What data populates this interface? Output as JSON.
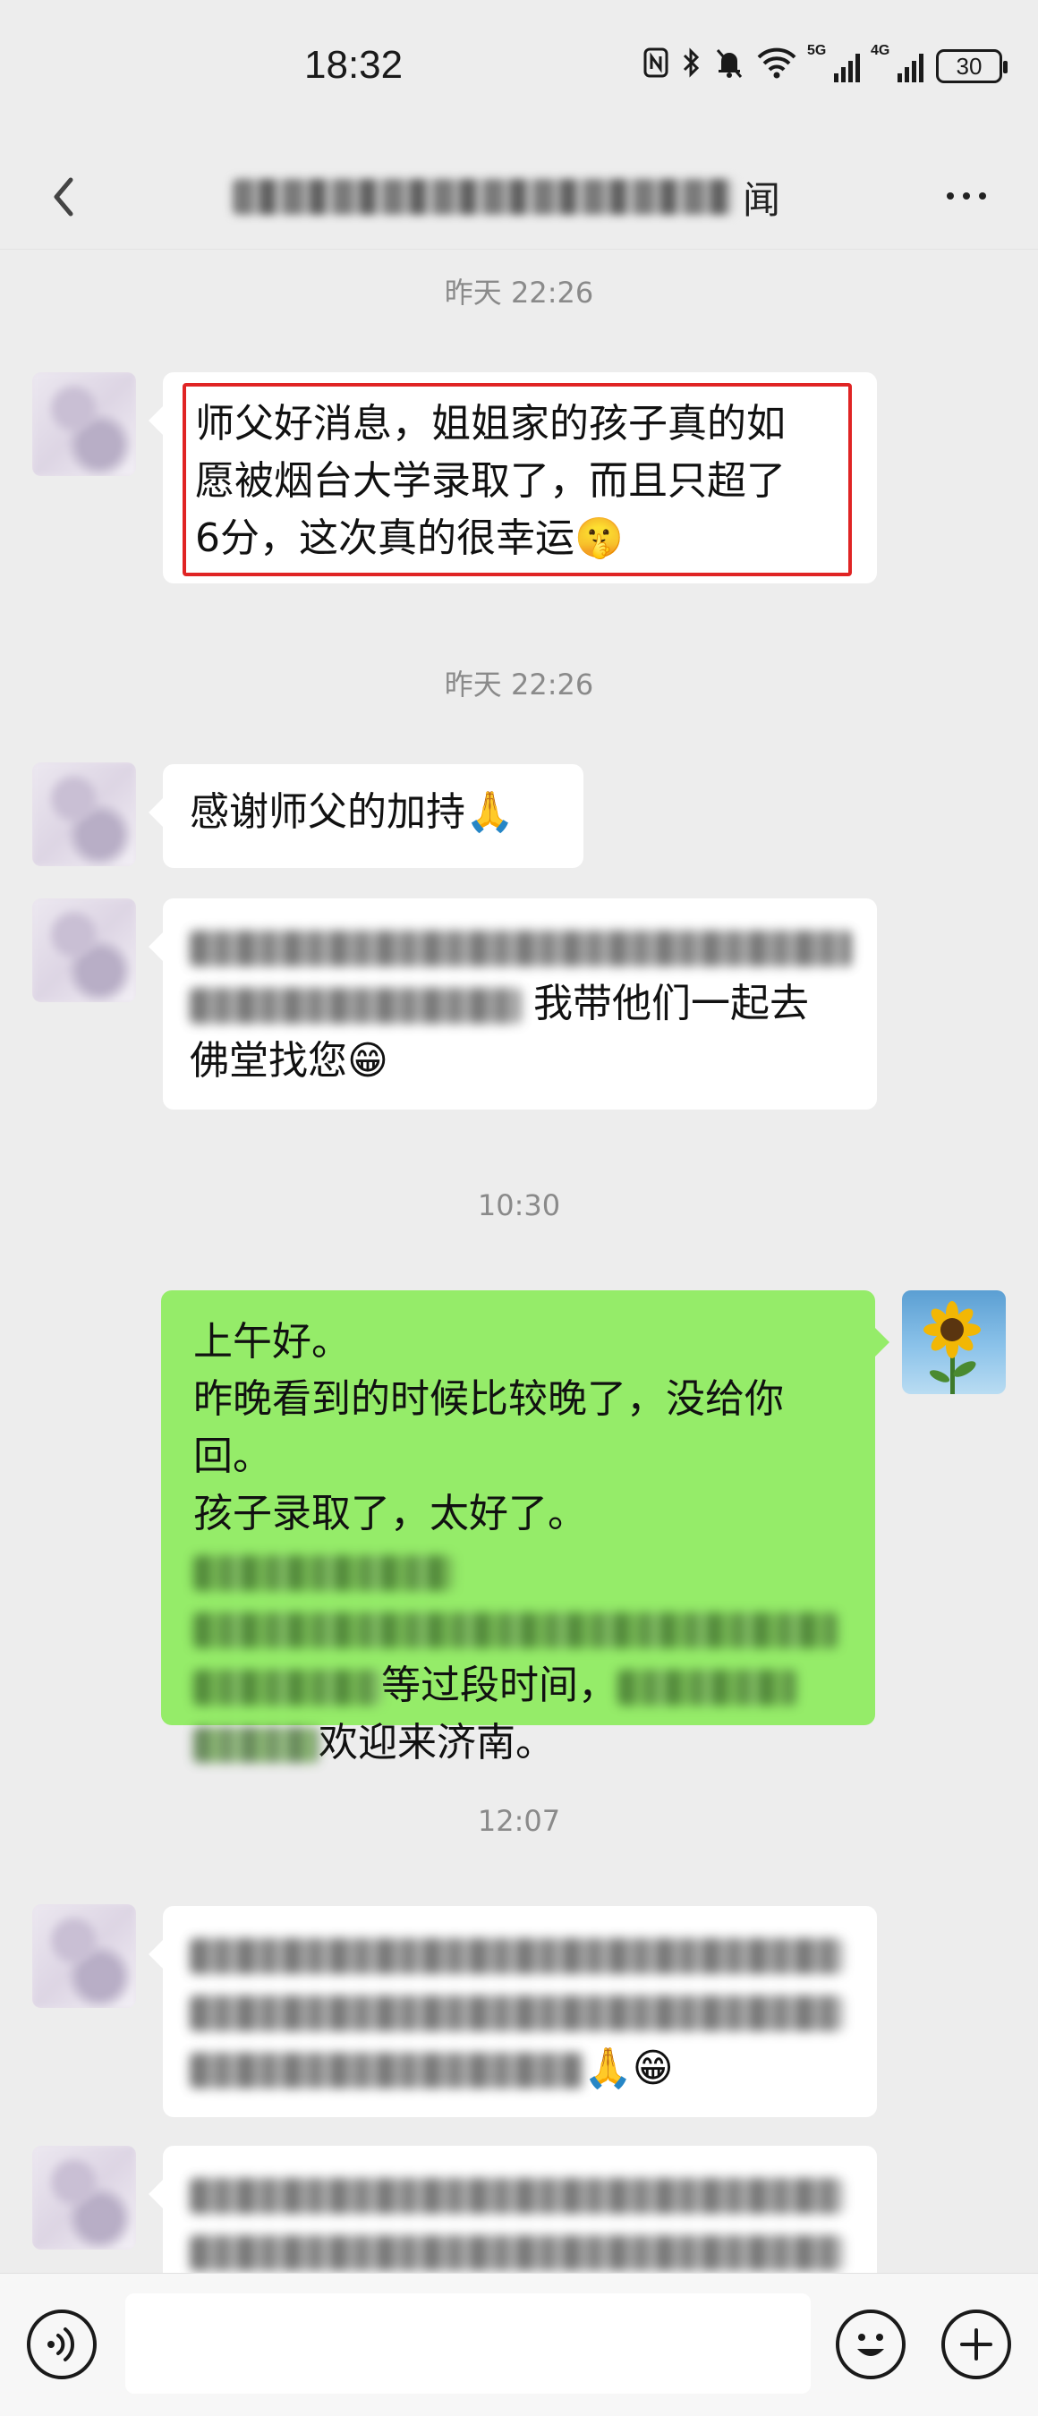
{
  "status_bar": {
    "time": "18:32",
    "network_5g": "5G",
    "network_4g": "4G",
    "battery": "30"
  },
  "header": {
    "title_suffix": "闻",
    "back_icon": "chevron-left-icon",
    "more_icon": "more-dots-icon"
  },
  "messages": [
    {
      "type": "timestamp",
      "text": "昨天 22:26"
    },
    {
      "type": "received",
      "lines": [
        "师父好消息，姐姐家的孩子真的如",
        "愿被烟台大学录取了，而且只超了",
        "6分，这次真的很幸运"
      ],
      "emoji": "🤫",
      "highlighted": true
    },
    {
      "type": "timestamp",
      "text": "昨天 22:26"
    },
    {
      "type": "received",
      "text": "感谢师父的加持",
      "emoji": "🙏"
    },
    {
      "type": "received",
      "visible_tail": "我带他们一起去",
      "line3": "佛堂找您",
      "emoji": "😁"
    },
    {
      "type": "timestamp",
      "text": "10:30"
    },
    {
      "type": "sent",
      "line1": "上午好。",
      "line2": "昨晚看到的时候比较晚了，没给你",
      "line3": "回。",
      "line4_visible": "孩子录取了，太好了。",
      "line6_visible": "等过段时间，",
      "line7_visible": "欢迎来济南。"
    },
    {
      "type": "timestamp",
      "text": "12:07"
    },
    {
      "type": "received",
      "emoji": "🙏😁"
    },
    {
      "type": "received"
    }
  ],
  "colors": {
    "background": "#ededed",
    "sent_bubble": "#95ec69",
    "received_bubble": "#ffffff",
    "highlight": "#e02424"
  }
}
